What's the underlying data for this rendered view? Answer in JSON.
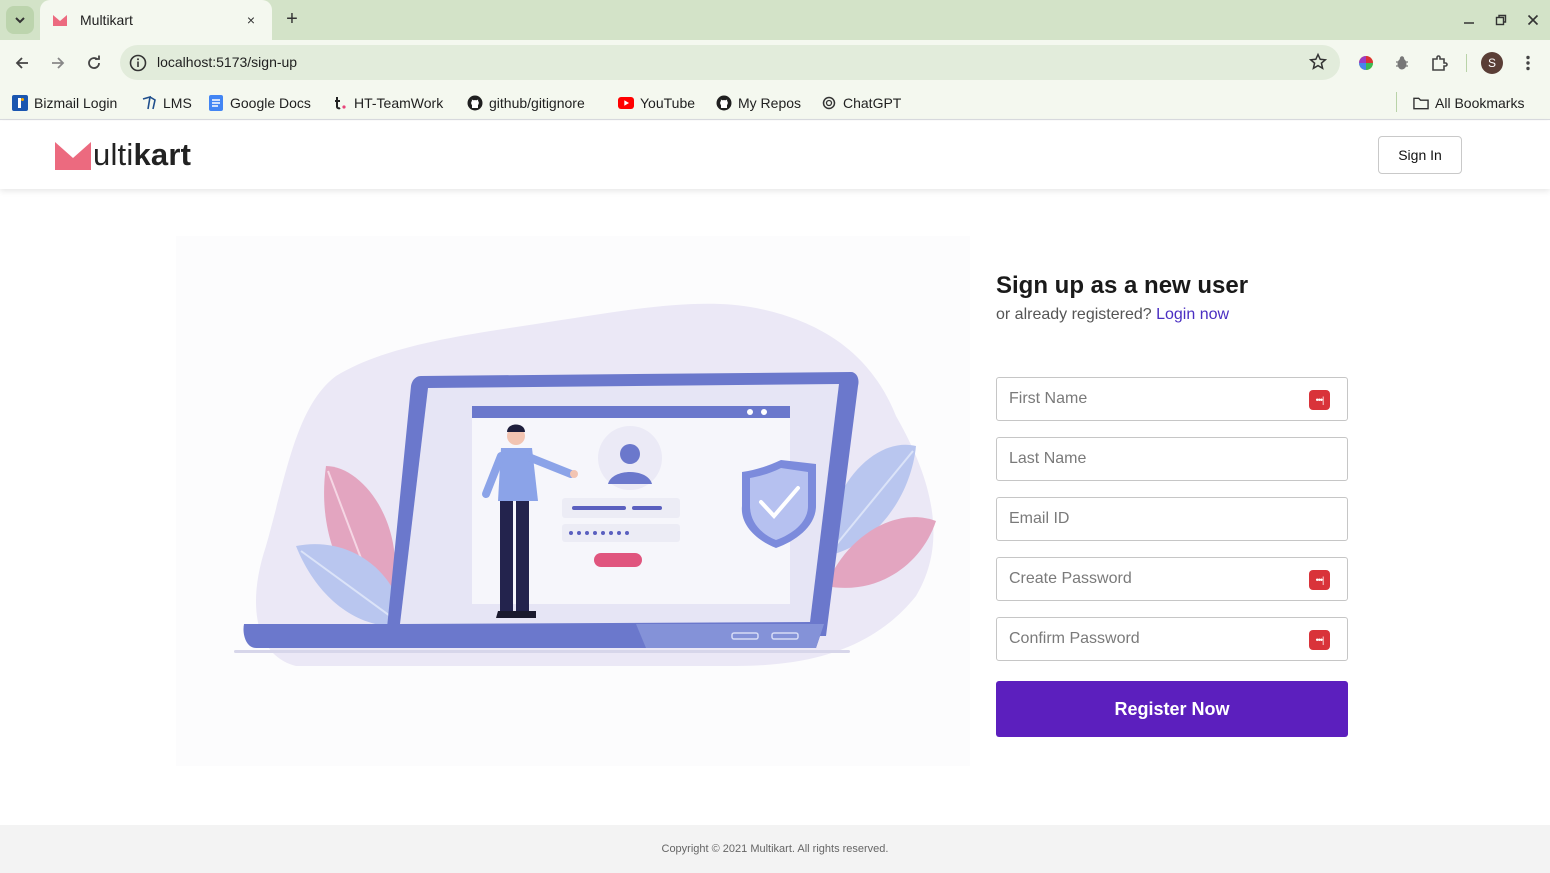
{
  "browser": {
    "tab": {
      "title": "Multikart",
      "close_label": "×"
    },
    "new_tab_label": "+",
    "address": "localhost:5173/sign-up",
    "profile_initial": "S",
    "bookmarks": [
      {
        "label": "Bizmail Login",
        "icon": "bizmail-icon"
      },
      {
        "label": "LMS",
        "icon": "lms-icon"
      },
      {
        "label": "Google Docs",
        "icon": "google-docs-icon"
      },
      {
        "label": "HT-TeamWork",
        "icon": "teamwork-icon"
      },
      {
        "label": "github/gitignore",
        "icon": "github-icon"
      },
      {
        "label": "YouTube",
        "icon": "youtube-icon"
      },
      {
        "label": "My Repos",
        "icon": "github-icon"
      },
      {
        "label": "ChatGPT",
        "icon": "chatgpt-icon"
      }
    ],
    "all_bookmarks_label": "All Bookmarks"
  },
  "header": {
    "logo_letter": "M",
    "logo_light": "ulti",
    "logo_bold": "kart",
    "signin_label": "Sign In"
  },
  "signup": {
    "title": "Sign up as a new user",
    "subtitle": "or already registered?",
    "login_link": "Login now",
    "fields": {
      "first_name": "First Name",
      "last_name": "Last Name",
      "email": "Email ID",
      "create_password": "Create Password",
      "confirm_password": "Confirm Password"
    },
    "register_label": "Register Now"
  },
  "footer": {
    "copyright": "Copyright © 2021 Multikart. All rights reserved."
  },
  "colors": {
    "brand_pink": "#ec6a7f",
    "brand_purple": "#5c1fbe",
    "link": "#4a2ec2",
    "password_manager_red": "#d9333a",
    "browser_frame": "#d3e3c8"
  }
}
